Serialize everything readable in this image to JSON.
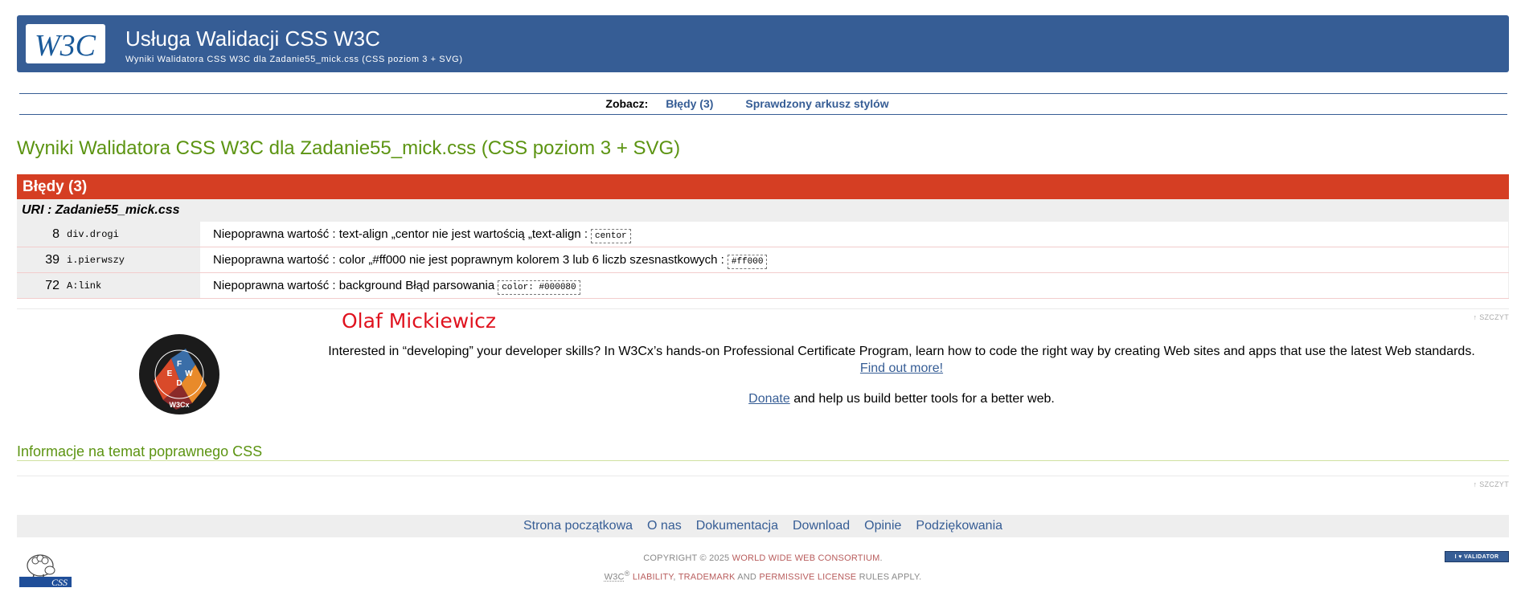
{
  "header": {
    "logo_text": "W3C",
    "title": "Usługa Walidacji CSS W3C",
    "subtitle": "Wyniki Walidatora CSS W3C dla Zadanie55_mick.css (CSS poziom 3 + SVG)"
  },
  "nav": {
    "label": "Zobacz:",
    "links": [
      "Błędy (3)",
      "Sprawdzony arkusz stylów"
    ]
  },
  "main": {
    "title": "Wyniki Walidatora CSS W3C dla Zadanie55_mick.css (CSS poziom 3 + SVG)",
    "errors_header": "Błędy (3)",
    "uri": "URI : Zadanie55_mick.css",
    "errors": [
      {
        "line": "8",
        "context": "div.drogi",
        "message": "Niepoprawna wartość : text-align „centor nie jest wartością „text-align :",
        "code": "centor"
      },
      {
        "line": "39",
        "context": "i.pierwszy",
        "message": "Niepoprawna wartość : color „#ff000 nie jest poprawnym kolorem 3 lub 6 liczb szesnastkowych :",
        "code": "#ff000"
      },
      {
        "line": "72",
        "context": "A:link",
        "message": "Niepoprawna wartość : background Błąd parsowania",
        "code": "color: #000080"
      }
    ],
    "top_link": "↑ SZCZYT"
  },
  "promo": {
    "author": "Olaf Mickiewicz",
    "text": "Interested in “developing” your developer skills? In W3Cx’s hands-on Professional Certificate Program, learn how to code the right way by creating Web sites and apps that use the latest Web standards.",
    "find_out": "Find out more!",
    "donate_link": "Donate",
    "donate_text": " and help us build better tools for a better web.",
    "badge_letters": [
      "F",
      "E",
      "D",
      "W"
    ],
    "badge_text": "W3Cx"
  },
  "info": {
    "title": "Informacje na temat poprawnego CSS",
    "top_link": "↑ SZCZYT"
  },
  "footer": {
    "links": [
      "Strona początkowa",
      "O nas",
      "Dokumentacja",
      "Download",
      "Opinie",
      "Podziękowania"
    ],
    "copyright_prefix": "COPYRIGHT © 2025 ",
    "copyright_org": "WORLD WIDE WEB CONSORTIUM",
    "copyright_suffix": ".",
    "w3c_mark": "W3C",
    "reg": "®",
    "liability": " LIABILITY",
    "sep1": ", ",
    "trademark": "TRADEMARK",
    "and": " AND ",
    "permissive": "PERMISSIVE LICENSE",
    "rules": " RULES APPLY.",
    "css_logo_text": "CSS",
    "i_love_validator": "I ♥ VALIDATOR"
  },
  "colors": {
    "brand": "#365d95",
    "error": "#d53e23",
    "green_title": "#5c9412",
    "author_red": "#e0131f"
  }
}
